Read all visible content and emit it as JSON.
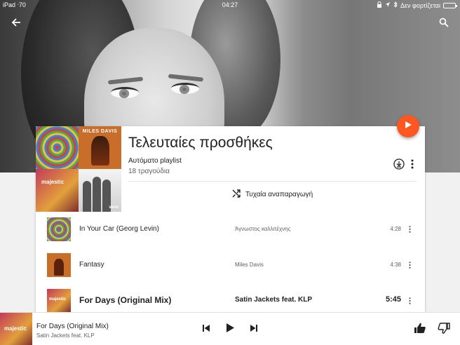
{
  "status_bar": {
    "left": "iPad ᐧ70",
    "time": "04:27",
    "right": "Δεν φορτίζεται"
  },
  "playlist": {
    "title": "Τελευταίες προσθήκες",
    "type": "Αυτόματο playlist",
    "count": "18 τραγούδια",
    "shuffle_label": "Τυχαία αναπαραγωγή",
    "collage_texts": {
      "miles": "MILES DAVIS",
      "majestic": "majestic",
      "vevo": "vevo"
    }
  },
  "tracks": [
    {
      "title": "In Your Car (Georg Levin)",
      "artist": "Άγνωστος καλλιτέχνης",
      "duration": "4:28"
    },
    {
      "title": "Fantasy",
      "artist": "Miles Davis",
      "duration": "4:38"
    },
    {
      "title": "For Days (Original Mix)",
      "artist": "Satin Jackets feat. KLP",
      "duration": "5:45",
      "thumb_text": "majestic"
    }
  ],
  "now_playing": {
    "title": "For Days (Original Mix)",
    "artist": "Satin Jackets feat. KLP",
    "thumb_text": "majestic"
  },
  "colors": {
    "accent": "#ff5722",
    "text": "#212121",
    "secondary": "#616161"
  },
  "icons": {
    "back": "arrow-back-icon",
    "search": "search-icon",
    "play_fab": "play-icon",
    "download": "download-icon",
    "more": "more-vert-icon",
    "shuffle": "shuffle-icon",
    "prev": "skip-previous-icon",
    "play": "play-icon",
    "next": "skip-next-icon",
    "thumb_up": "thumb-up-icon",
    "thumb_down": "thumb-down-icon"
  }
}
